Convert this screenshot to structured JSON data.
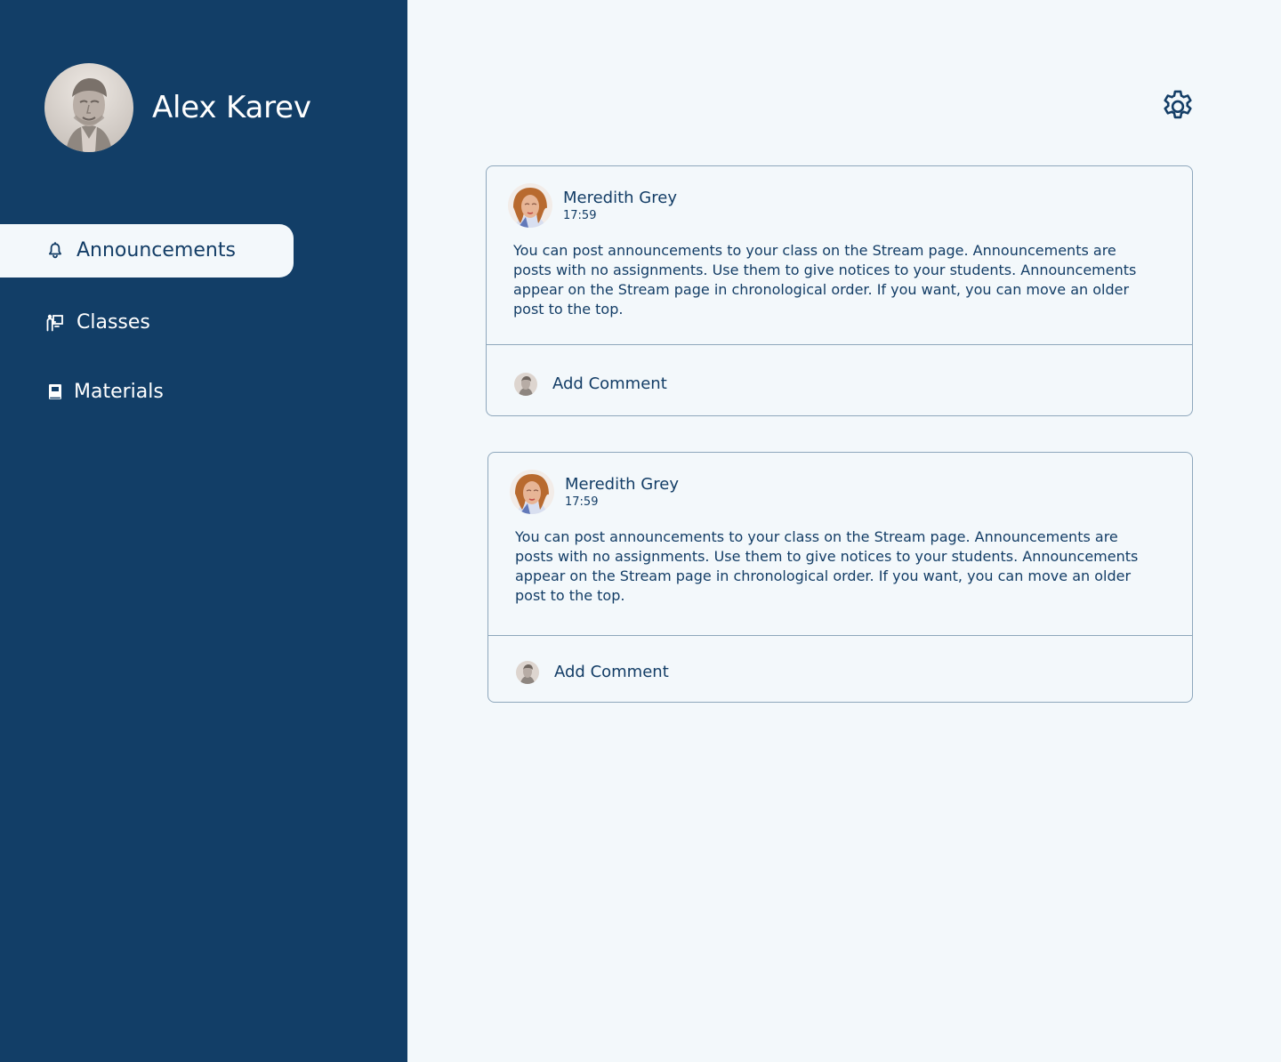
{
  "user": {
    "name": "Alex Karev"
  },
  "nav": {
    "items": [
      {
        "label": "Announcements",
        "icon": "bell-icon",
        "active": true
      },
      {
        "label": "Classes",
        "icon": "teacher-board-icon",
        "active": false
      },
      {
        "label": "Materials",
        "icon": "book-icon",
        "active": false
      }
    ]
  },
  "posts": [
    {
      "author": "Meredith Grey",
      "time": "17:59",
      "body": "You can post announcements to your class on the Stream page. Announcements are posts with no assignments. Use them to give notices to your students. Announcements appear on the Stream page in chronological order. If you want, you can move an older post to the top.",
      "comment_label": "Add Comment"
    },
    {
      "author": "Meredith Grey",
      "time": "17:59",
      "body": "You can post announcements to your class on the Stream page. Announcements are posts with no assignments. Use them to give notices to your students. Announcements appear on the Stream page in chronological order. If you want, you can move an older post to the top.",
      "comment_label": "Add Comment"
    }
  ],
  "colors": {
    "sidebar": "#123e67",
    "background": "#f3f8fb",
    "text": "#133d66",
    "border": "#8ea7bc",
    "active_nav_text": "#133d66",
    "sidebar_text": "#ffffff"
  },
  "icons": {
    "settings": "gear-icon"
  }
}
